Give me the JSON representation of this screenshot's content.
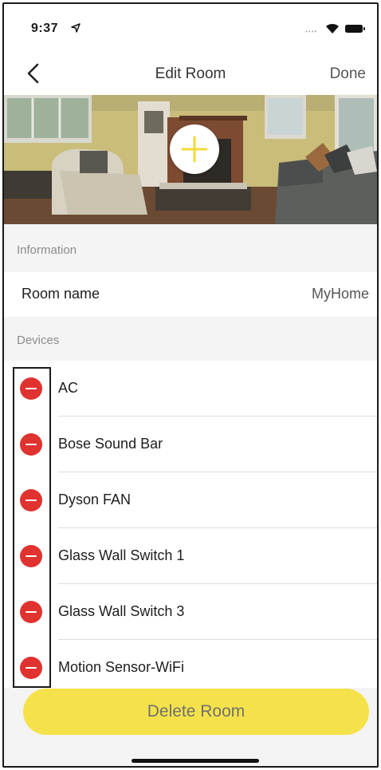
{
  "status_bar": {
    "time": "9:37",
    "location_icon": "location-arrow-icon",
    "signal_icon": "cellular-signal-icon",
    "wifi_icon": "wifi-icon",
    "battery_icon": "battery-icon"
  },
  "nav": {
    "back_icon": "chevron-left-icon",
    "title": "Edit Room",
    "done_label": "Done"
  },
  "photo": {
    "add_icon": "plus-icon",
    "accent_color": "#f5e24a"
  },
  "information": {
    "header": "Information",
    "room_name_label": "Room name",
    "room_name_value": "MyHome"
  },
  "devices": {
    "header": "Devices",
    "remove_icon": "minus-circle-icon",
    "remove_color": "#e0322f",
    "items": [
      {
        "name": "AC"
      },
      {
        "name": "Bose Sound Bar"
      },
      {
        "name": "Dyson FAN"
      },
      {
        "name": "Glass Wall Switch 1"
      },
      {
        "name": "Glass Wall Switch 3"
      },
      {
        "name": "Motion Sensor-WiFi"
      }
    ]
  },
  "actions": {
    "delete_label": "Delete Room",
    "delete_color": "#f5e24a"
  }
}
